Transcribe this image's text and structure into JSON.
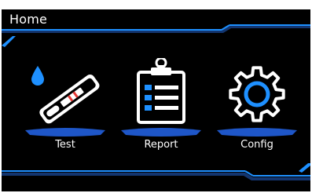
{
  "header": {
    "title": "Home"
  },
  "menu": [
    {
      "id": "test",
      "label": "Test",
      "icon": "test-strip-icon"
    },
    {
      "id": "report",
      "label": "Report",
      "icon": "clipboard-icon"
    },
    {
      "id": "config",
      "label": "Config",
      "icon": "gear-icon"
    }
  ],
  "colors": {
    "background": "#000000",
    "accent": "#1e90ff",
    "accent_dark": "#13356f",
    "text": "#ffffff"
  }
}
